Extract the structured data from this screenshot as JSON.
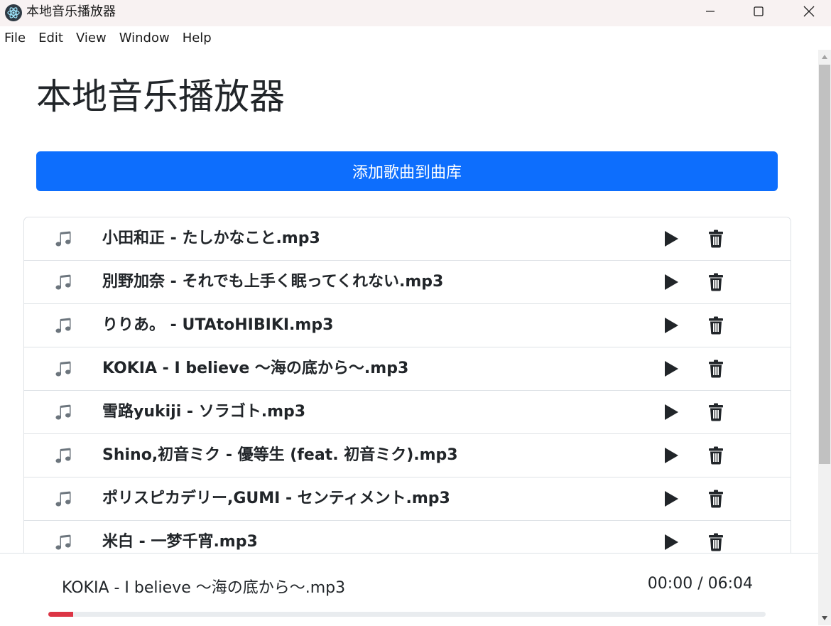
{
  "window": {
    "title": "本地音乐播放器"
  },
  "menu": [
    "File",
    "Edit",
    "View",
    "Window",
    "Help"
  ],
  "page": {
    "title": "本地音乐播放器",
    "add_button_label": "添加歌曲到曲库"
  },
  "songs": [
    "小田和正 - たしかなこと.mp3",
    "別野加奈 - それでも上手く眠ってくれない.mp3",
    "りりあ。 - UTAtoHIBIKI.mp3",
    "KOKIA - I believe 〜海の底から〜.mp3",
    "雪路yukiji - ソラゴト.mp3",
    "Shino,初音ミク - 優等生 (feat. 初音ミク).mp3",
    "ポリスピカデリー,GUMI - センティメント.mp3",
    "米白 - 一梦千宵.mp3"
  ],
  "player": {
    "now_playing": "KOKIA - I believe 〜海の底から〜.mp3",
    "time": "00:00 / 06:04",
    "progress_fraction": 0.035
  },
  "colors": {
    "accent": "#0d6efd",
    "progress": "#dc3545",
    "border": "#dee2e6"
  },
  "icons": {
    "row_leading": "music-note-icon",
    "row_play": "play-icon",
    "row_delete": "trash-icon"
  }
}
